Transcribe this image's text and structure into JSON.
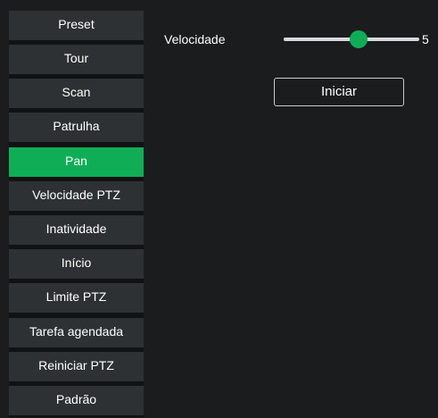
{
  "sidebar": {
    "items": [
      {
        "label": "Preset",
        "active": false
      },
      {
        "label": "Tour",
        "active": false
      },
      {
        "label": "Scan",
        "active": false
      },
      {
        "label": "Patrulha",
        "active": false
      },
      {
        "label": "Pan",
        "active": true
      },
      {
        "label": "Velocidade PTZ",
        "active": false
      },
      {
        "label": "Inatividade",
        "active": false
      },
      {
        "label": "Início",
        "active": false
      },
      {
        "label": "Limite PTZ",
        "active": false
      },
      {
        "label": "Tarefa agendada",
        "active": false
      },
      {
        "label": "Reiniciar PTZ",
        "active": false
      },
      {
        "label": "Padrão",
        "active": false
      }
    ]
  },
  "main": {
    "speed": {
      "label": "Velocidade",
      "value": "5",
      "level_fraction": 0.55
    },
    "start_button_label": "Iniciar"
  },
  "colors": {
    "accent": "#0fae56",
    "menu_item_bg": "#2e3133",
    "panel_bg": "#1b1c1d",
    "track": "#d6d8da"
  }
}
